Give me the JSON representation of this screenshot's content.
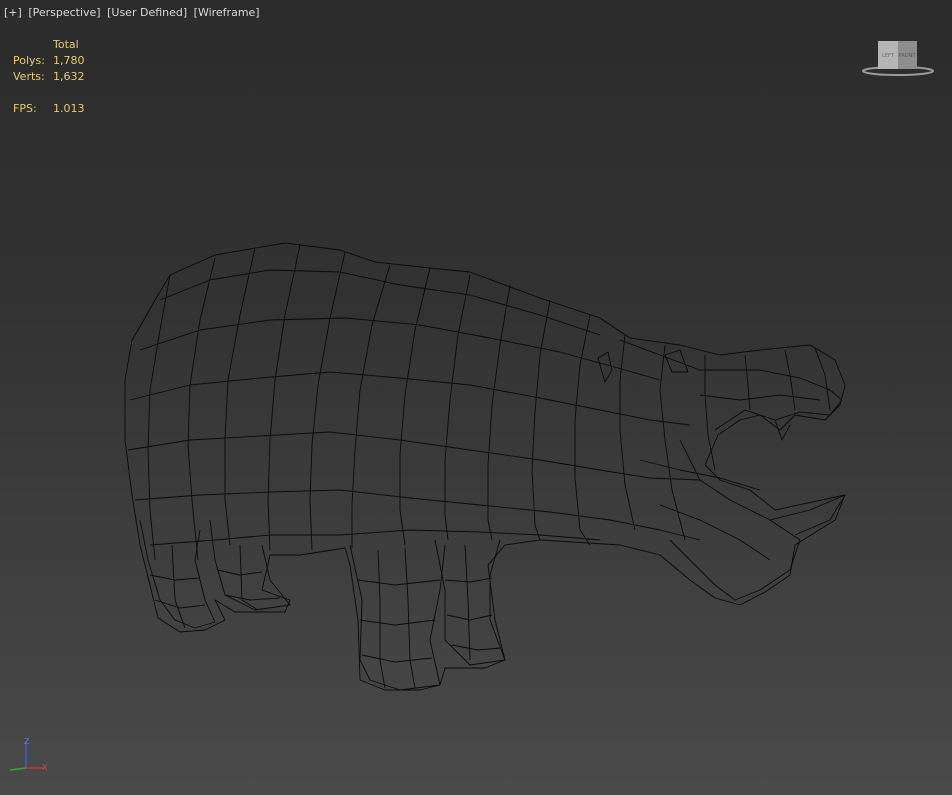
{
  "viewport": {
    "labels": [
      "[+]",
      "[Perspective]",
      "[User Defined]",
      "[Wireframe]"
    ]
  },
  "stats": {
    "header": "Total",
    "polys_label": "Polys:",
    "polys_value": "1,780",
    "verts_label": "Verts:",
    "verts_value": "1,632",
    "fps_label": "FPS:",
    "fps_value": "1.013"
  },
  "viewcube": {
    "left_face": "LEFT",
    "right_face": "FRONT"
  },
  "axes": {
    "z": "Z",
    "x": "X"
  },
  "colors": {
    "stats_text": "#e8c96a",
    "label_text": "#d9d9d9",
    "wire": "#0a0a0a",
    "axis_x": "#c0392b",
    "axis_y": "#3aa63a",
    "axis_z": "#3a5fcd"
  },
  "icons": [
    "viewcube-icon",
    "axis-tripod-icon"
  ]
}
